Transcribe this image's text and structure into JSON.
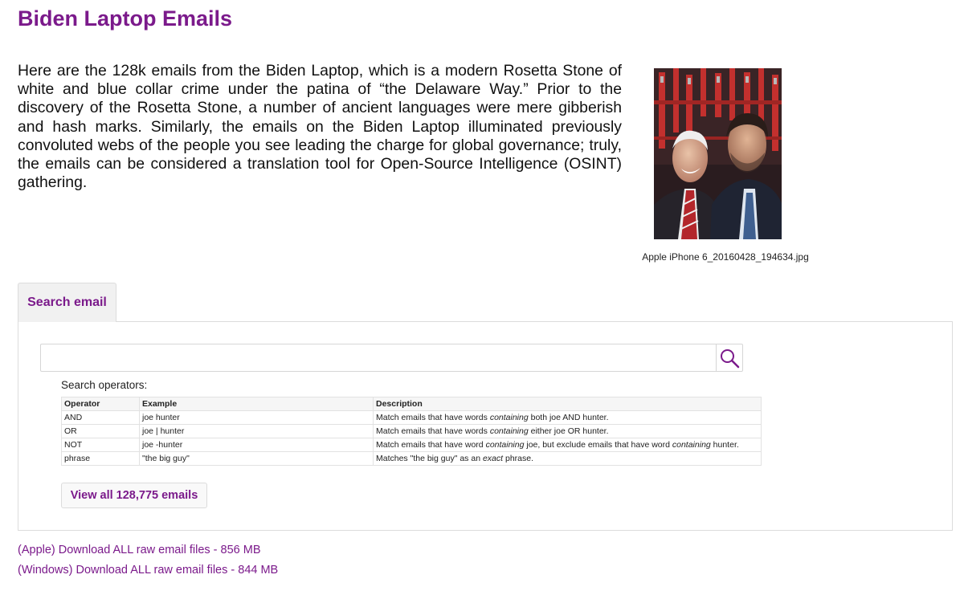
{
  "page": {
    "title": "Biden Laptop Emails"
  },
  "intro": {
    "text": "Here are the 128k emails from the Biden Laptop, which is a modern Rosetta Stone of white and blue collar crime under the patina of “the Delaware Way.” Prior to the discovery of the Rosetta Stone, a number of ancient languages were mere gibberish and hash marks. Similarly, the emails on the Biden Laptop illuminated previously convoluted webs of the people you see leading the charge for global governance; truly, the emails can be considered a translation tool for Open-Source Intelligence (OSINT) gathering."
  },
  "photo": {
    "caption": "Apple iPhone 6_20160428_194634.jpg"
  },
  "tabs": [
    {
      "label": "Search email",
      "active": true
    }
  ],
  "search": {
    "value": "",
    "placeholder": "",
    "button_icon": "search-icon",
    "operators_label": "Search operators:"
  },
  "operators_table": {
    "headers": [
      "Operator",
      "Example",
      "Description"
    ],
    "rows": [
      {
        "operator": "AND",
        "example": "joe hunter",
        "desc_pre": "Match emails that have words ",
        "desc_em": "containing",
        "desc_mid": " both joe AND hunter.",
        "desc_em2": "",
        "desc_post": ""
      },
      {
        "operator": "OR",
        "example": "joe | hunter",
        "desc_pre": "Match emails that have words ",
        "desc_em": "containing",
        "desc_mid": " either joe OR hunter.",
        "desc_em2": "",
        "desc_post": ""
      },
      {
        "operator": "NOT",
        "example": "joe -hunter",
        "desc_pre": "Match emails that have word ",
        "desc_em": "containing",
        "desc_mid": " joe, but exclude emails that have word ",
        "desc_em2": "containing",
        "desc_post": " hunter."
      },
      {
        "operator": "phrase",
        "example": "\"the big guy\"",
        "desc_pre": "Matches \"the big guy\" as an ",
        "desc_em": "exact",
        "desc_mid": " phrase.",
        "desc_em2": "",
        "desc_post": ""
      }
    ]
  },
  "view_all": {
    "label": "View all 128,775 emails"
  },
  "downloads": [
    {
      "label": "(Apple) Download ALL raw email files - 856 MB"
    },
    {
      "label": "(Windows) Download ALL raw email files - 844 MB"
    }
  ],
  "colors": {
    "accent": "#7b1a8b",
    "text": "#222222",
    "border": "#dcdcdc"
  }
}
